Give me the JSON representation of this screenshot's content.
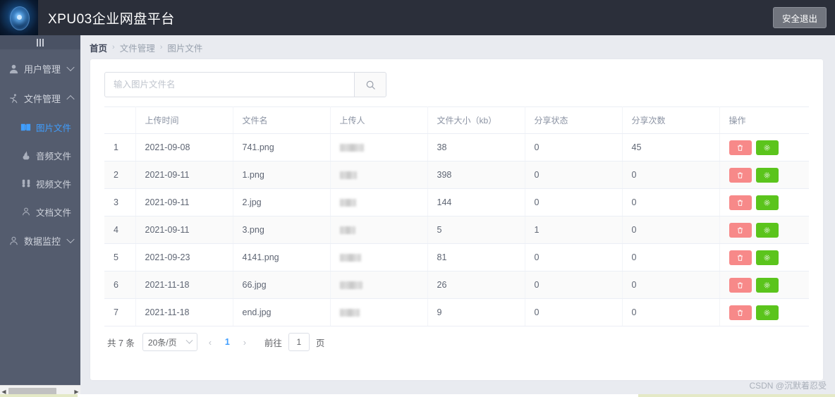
{
  "header": {
    "title": "XPU03企业网盘平台",
    "logout_label": "安全退出",
    "logo_icon": "network-sphere-logo"
  },
  "sidebar": {
    "collapse_icon": "hamburger-collapse-icon",
    "items": [
      {
        "label": "用户管理",
        "icon": "user-icon",
        "arrow": "chevron-down-icon",
        "active": false
      },
      {
        "label": "文件管理",
        "icon": "running-person-icon",
        "arrow": "chevron-up-icon",
        "active": false
      },
      {
        "label": "图片文件",
        "icon": "book-icon",
        "active": true
      },
      {
        "label": "音频文件",
        "icon": "flame-icon",
        "active": false
      },
      {
        "label": "视频文件",
        "icon": "binoculars-icon",
        "active": false
      },
      {
        "label": "文档文件",
        "icon": "person-icon",
        "active": false
      },
      {
        "label": "数据监控",
        "icon": "person-icon",
        "arrow": "chevron-down-icon",
        "active": false
      }
    ]
  },
  "breadcrumb": {
    "items": [
      "首页",
      "文件管理",
      "图片文件"
    ],
    "separator": "›"
  },
  "search": {
    "placeholder": "输入图片文件名",
    "value": "",
    "button_icon": "search-icon"
  },
  "table": {
    "columns": [
      "",
      "上传时间",
      "文件名",
      "上传人",
      "文件大小（kb）",
      "分享状态",
      "分享次数",
      "操作"
    ],
    "rows": [
      {
        "index": "1",
        "date": "2021-09-08",
        "filename": "741.png",
        "uploader_masked": true,
        "uploader_width": 34,
        "size": "38",
        "share_status": "0",
        "share_count": "45"
      },
      {
        "index": "2",
        "date": "2021-09-11",
        "filename": "1.png",
        "uploader_masked": true,
        "uploader_width": 24,
        "size": "398",
        "share_status": "0",
        "share_count": "0"
      },
      {
        "index": "3",
        "date": "2021-09-11",
        "filename": "2.jpg",
        "uploader_masked": true,
        "uploader_width": 23,
        "size": "144",
        "share_status": "0",
        "share_count": "0"
      },
      {
        "index": "4",
        "date": "2021-09-11",
        "filename": "3.png",
        "uploader_masked": true,
        "uploader_width": 22,
        "size": "5",
        "share_status": "1",
        "share_count": "0"
      },
      {
        "index": "5",
        "date": "2021-09-23",
        "filename": "4141.png",
        "uploader_masked": true,
        "uploader_width": 30,
        "size": "81",
        "share_status": "0",
        "share_count": "0"
      },
      {
        "index": "6",
        "date": "2021-11-18",
        "filename": "66.jpg",
        "uploader_masked": true,
        "uploader_width": 32,
        "size": "26",
        "share_status": "0",
        "share_count": "0"
      },
      {
        "index": "7",
        "date": "2021-11-18",
        "filename": "end.jpg",
        "uploader_masked": true,
        "uploader_width": 28,
        "size": "9",
        "share_status": "0",
        "share_count": "0"
      }
    ],
    "actions": {
      "delete_icon": "trash-icon",
      "share_icon": "gear-icon",
      "delete_color": "#f78989",
      "share_color": "#5bc41c"
    }
  },
  "pagination": {
    "total_label": "共 7 条",
    "page_size_label": "20条/页",
    "prev_icon": "chevron-left-icon",
    "next_icon": "chevron-right-icon",
    "current_page": "1",
    "jump_prefix": "前往",
    "jump_value": "1",
    "jump_suffix": "页"
  },
  "watermark": {
    "text": "CSDN @沉默着忍受"
  },
  "colors": {
    "header_bg": "#2b2f3a",
    "sidebar_bg": "#545c6e",
    "page_bg": "#e9ebf0",
    "accent": "#409eff"
  }
}
